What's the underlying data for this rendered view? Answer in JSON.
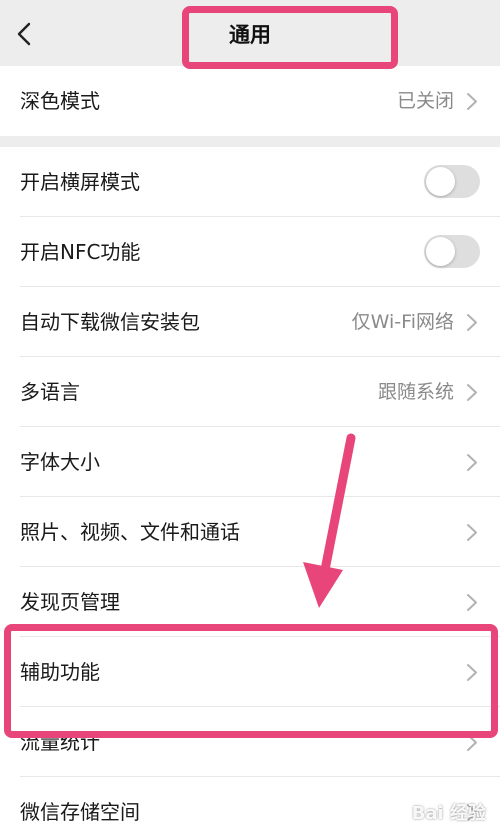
{
  "navbar": {
    "title": "通用",
    "back_icon": "chevron-left-icon"
  },
  "settings": {
    "dark_mode": {
      "label": "深色模式",
      "value": "已关闭"
    },
    "landscape": {
      "label": "开启横屏模式",
      "enabled": false
    },
    "nfc": {
      "label": "开启NFC功能",
      "enabled": false
    },
    "auto_download": {
      "label": "自动下载微信安装包",
      "value": "仅Wi-Fi网络"
    },
    "language": {
      "label": "多语言",
      "value": "跟随系统"
    },
    "font_size": {
      "label": "字体大小"
    },
    "media": {
      "label": "照片、视频、文件和通话"
    },
    "discover": {
      "label": "发现页管理"
    },
    "accessibility": {
      "label": "辅助功能"
    },
    "traffic": {
      "label": "流量统计"
    },
    "storage": {
      "label": "微信存储空间"
    }
  },
  "annotation": {
    "color": "#e8457b",
    "watermark": "Bai 经验"
  },
  "colors": {
    "background": "#ededed",
    "row_background": "#ffffff",
    "toggle_off": "#dedede",
    "secondary_text": "#8a8a8a"
  }
}
